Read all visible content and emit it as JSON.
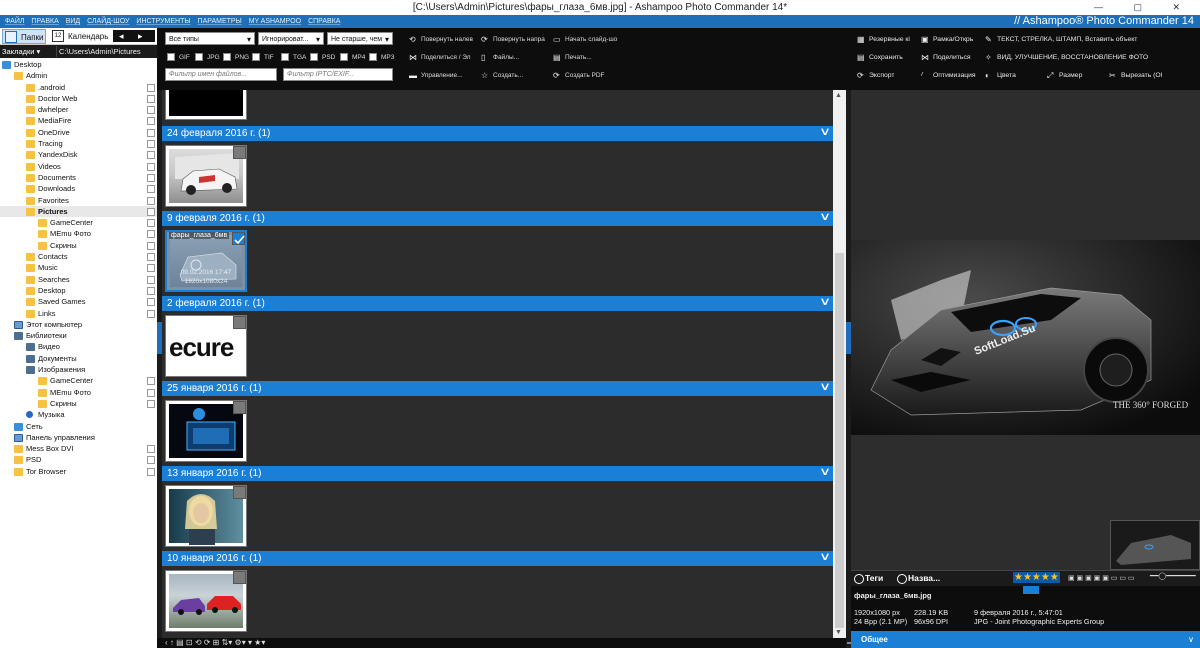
{
  "window": {
    "title": "[C:\\Users\\Admin\\Pictures\\фары_глаза_6мв.jpg] - Ashampoo Photo Commander 14*",
    "controls": "—  ▢  ✕"
  },
  "menu": {
    "items": [
      "ФАЙЛ",
      "ПРАВКА",
      "ВИД",
      "СЛАЙД-ШОУ",
      "ИНСТРУМЕНТЫ",
      "ПАРАМЕТРЫ",
      "МY ASHAMPOO",
      "СПРАВКА"
    ],
    "brand": "// Ashampoo® Photo Commander 14"
  },
  "left": {
    "tab_folders": "Папки",
    "tab_calendar": "Календарь",
    "calendar_day": "12",
    "nav": "◂ ▸",
    "bookmarks_label": "Закладки ▾",
    "path": "C:\\Users\\Admin\\Pictures",
    "tree": [
      {
        "label": "Desktop",
        "indent": 0,
        "icon": "blue"
      },
      {
        "label": "Admin",
        "indent": 1,
        "icon": "folder"
      },
      {
        "label": ".android",
        "indent": 2,
        "icon": "folder",
        "cb": true
      },
      {
        "label": "Doctor Web",
        "indent": 2,
        "icon": "folder",
        "cb": true
      },
      {
        "label": "dwhelper",
        "indent": 2,
        "icon": "folder",
        "cb": true
      },
      {
        "label": "MediaFire",
        "indent": 2,
        "icon": "folder",
        "cb": true
      },
      {
        "label": "OneDrive",
        "indent": 2,
        "icon": "folder",
        "cb": true
      },
      {
        "label": "Tracing",
        "indent": 2,
        "icon": "folder",
        "cb": true
      },
      {
        "label": "YandexDisk",
        "indent": 2,
        "icon": "folder",
        "cb": true
      },
      {
        "label": "Videos",
        "indent": 2,
        "icon": "folder",
        "cb": true
      },
      {
        "label": "Documents",
        "indent": 2,
        "icon": "folder",
        "cb": true
      },
      {
        "label": "Downloads",
        "indent": 2,
        "icon": "folder",
        "cb": true
      },
      {
        "label": "Favorites",
        "indent": 2,
        "icon": "folder",
        "cb": true
      },
      {
        "label": "Pictures",
        "indent": 2,
        "icon": "folder",
        "cb": true,
        "selected": true
      },
      {
        "label": "GameCenter",
        "indent": 3,
        "icon": "folder",
        "cb": true
      },
      {
        "label": "MEmu Фото",
        "indent": 3,
        "icon": "folder",
        "cb": true
      },
      {
        "label": "Скрины",
        "indent": 3,
        "icon": "folder",
        "cb": true
      },
      {
        "label": "Contacts",
        "indent": 2,
        "icon": "folder",
        "cb": true
      },
      {
        "label": "Music",
        "indent": 2,
        "icon": "folder",
        "cb": true
      },
      {
        "label": "Searches",
        "indent": 2,
        "icon": "folder",
        "cb": true
      },
      {
        "label": "Desktop",
        "indent": 2,
        "icon": "folder",
        "cb": true
      },
      {
        "label": "Saved Games",
        "indent": 2,
        "icon": "folder",
        "cb": true
      },
      {
        "label": "Links",
        "indent": 2,
        "icon": "folder",
        "cb": true
      },
      {
        "label": "Этот компьютер",
        "indent": 1,
        "icon": "pc"
      },
      {
        "label": "Библиотеки",
        "indent": 1,
        "icon": "dark"
      },
      {
        "label": "Видео",
        "indent": 2,
        "icon": "dark"
      },
      {
        "label": "Документы",
        "indent": 2,
        "icon": "dark"
      },
      {
        "label": "Изображения",
        "indent": 2,
        "icon": "dark"
      },
      {
        "label": "GameCenter",
        "indent": 3,
        "icon": "folder",
        "cb": true
      },
      {
        "label": "MEmu Фото",
        "indent": 3,
        "icon": "folder",
        "cb": true
      },
      {
        "label": "Скрины",
        "indent": 3,
        "icon": "folder",
        "cb": true
      },
      {
        "label": "Музыка",
        "indent": 2,
        "icon": "note"
      },
      {
        "label": "Сеть",
        "indent": 1,
        "icon": "blue"
      },
      {
        "label": "Панель управления",
        "indent": 1,
        "icon": "pc"
      },
      {
        "label": "Mess Box DVI",
        "indent": 1,
        "icon": "folder",
        "cb": true
      },
      {
        "label": "PSD",
        "indent": 1,
        "icon": "folder",
        "cb": true
      },
      {
        "label": "Tor Browser",
        "indent": 1,
        "icon": "folder",
        "cb": true
      }
    ]
  },
  "toolbar": {
    "type_select": "Все типы",
    "ignore_select": "Игнорироват...",
    "age_select": "Не старше, чем",
    "formats": [
      "GIF",
      "JPG",
      "PNG",
      "TIF",
      "TGA",
      "PSD",
      "MP4",
      "MP3"
    ],
    "filename_filter_placeholder": "Фильтр имен файлов...",
    "iptc_filter_placeholder": "Фильтр IPTC/EXIF...",
    "manage_label": "Управление...",
    "create_label": "Создать...",
    "create_pdf_label": "Создать PDF",
    "rotate_left": "Повернуть налев",
    "rotate_right": "Повернуть напра",
    "slideshow": "Начать слайд-шо",
    "share": "Поделиться / Эл",
    "files": "Файлы...",
    "print": "Печать...",
    "right": {
      "backup": "Резервные кі",
      "frame": "Рамка/Открь",
      "text": "ТЕКСТ, СТРЕЛКА, ШТАМП, Вставить объект",
      "save": "Сохранить",
      "share": "Поделиться",
      "enhance": "ВИД, УЛУЧШЕНИЕ, ВОССТАНОВЛЕНИЕ ФОТО",
      "export": "Экспорт",
      "optimize": "Оптимизация",
      "colors": "Цвета",
      "size": "Размер",
      "cut": "Вырезать (Ol"
    }
  },
  "groups": [
    {
      "label": "24 февраля 2016 г. (1)"
    },
    {
      "label": "9 февраля 2016 г. (1)"
    },
    {
      "label": "2 февраля 2016 г. (1)"
    },
    {
      "label": "25 января 2016 г. (1)"
    },
    {
      "label": "13 января 2016 г. (1)"
    },
    {
      "label": "10 января 2016 г. (1)"
    }
  ],
  "selected_thumb": {
    "filename": "фары_глаза_6мв",
    "date": "09.02.2016 17:47",
    "dims": "1920x1080x24"
  },
  "thumb_texts": {
    "secure": "ecure"
  },
  "preview": {
    "watermark": "SoftLoad.Su",
    "brand_text": "THE 360° FORGED"
  },
  "tags_bar": {
    "tags": "Теги",
    "name": "Назва..."
  },
  "info": {
    "filename": "фары_глаза_6мв.jpg",
    "resolution": "1920x1080 px",
    "filesize": "228.19 KB",
    "date": "9 февраля 2016 г., 5:47:01",
    "bpp": "24 Bpp (2.1 MP)",
    "dpi": "96x96 DPI",
    "type": "JPG - Joint Photographic Experts Group"
  },
  "general_label": "Общее",
  "rating_stars": 5,
  "bottom_icons": "‹   ↑   ▤   ⊡   ⟲   ⟳   ⊞   ⇅▾  ⚙▾   ▾   ★▾"
}
